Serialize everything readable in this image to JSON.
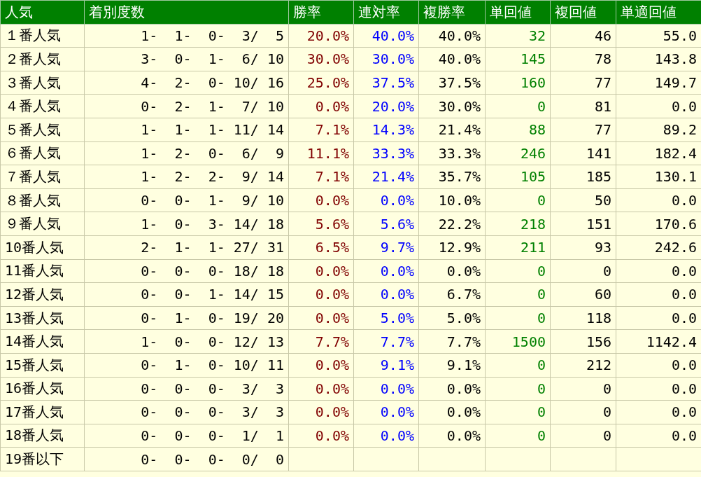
{
  "table": {
    "columns": [
      {
        "label": "人気",
        "kind": "name"
      },
      {
        "label": "着別度数",
        "kind": "record"
      },
      {
        "label": "勝率",
        "kind": "win"
      },
      {
        "label": "連対率",
        "kind": "quinella"
      },
      {
        "label": "複勝率",
        "kind": "plain"
      },
      {
        "label": "単回値",
        "kind": "return"
      },
      {
        "label": "複回値",
        "kind": "plain"
      },
      {
        "label": "単適回値",
        "kind": "plain"
      }
    ],
    "rows": [
      [
        "１番人気",
        "1-  1-  0-  3/  5",
        "20.0%",
        "40.0%",
        "40.0%",
        "32",
        "46",
        "55.0"
      ],
      [
        "２番人気",
        "3-  0-  1-  6/ 10",
        "30.0%",
        "30.0%",
        "40.0%",
        "145",
        "78",
        "143.8"
      ],
      [
        "３番人気",
        "4-  2-  0- 10/ 16",
        "25.0%",
        "37.5%",
        "37.5%",
        "160",
        "77",
        "149.7"
      ],
      [
        "４番人気",
        "0-  2-  1-  7/ 10",
        "0.0%",
        "20.0%",
        "30.0%",
        "0",
        "81",
        "0.0"
      ],
      [
        "５番人気",
        "1-  1-  1- 11/ 14",
        "7.1%",
        "14.3%",
        "21.4%",
        "88",
        "77",
        "89.2"
      ],
      [
        "６番人気",
        "1-  2-  0-  6/  9",
        "11.1%",
        "33.3%",
        "33.3%",
        "246",
        "141",
        "182.4"
      ],
      [
        "７番人気",
        "1-  2-  2-  9/ 14",
        "7.1%",
        "21.4%",
        "35.7%",
        "105",
        "185",
        "130.1"
      ],
      [
        "８番人気",
        "0-  0-  1-  9/ 10",
        "0.0%",
        "0.0%",
        "10.0%",
        "0",
        "50",
        "0.0"
      ],
      [
        "９番人気",
        "1-  0-  3- 14/ 18",
        "5.6%",
        "5.6%",
        "22.2%",
        "218",
        "151",
        "170.6"
      ],
      [
        "10番人気",
        "2-  1-  1- 27/ 31",
        "6.5%",
        "9.7%",
        "12.9%",
        "211",
        "93",
        "242.6"
      ],
      [
        "11番人気",
        "0-  0-  0- 18/ 18",
        "0.0%",
        "0.0%",
        "0.0%",
        "0",
        "0",
        "0.0"
      ],
      [
        "12番人気",
        "0-  0-  1- 14/ 15",
        "0.0%",
        "0.0%",
        "6.7%",
        "0",
        "60",
        "0.0"
      ],
      [
        "13番人気",
        "0-  1-  0- 19/ 20",
        "0.0%",
        "5.0%",
        "5.0%",
        "0",
        "118",
        "0.0"
      ],
      [
        "14番人気",
        "1-  0-  0- 12/ 13",
        "7.7%",
        "7.7%",
        "7.7%",
        "1500",
        "156",
        "1142.4"
      ],
      [
        "15番人気",
        "0-  1-  0- 10/ 11",
        "0.0%",
        "9.1%",
        "9.1%",
        "0",
        "212",
        "0.0"
      ],
      [
        "16番人気",
        "0-  0-  0-  3/  3",
        "0.0%",
        "0.0%",
        "0.0%",
        "0",
        "0",
        "0.0"
      ],
      [
        "17番人気",
        "0-  0-  0-  3/  3",
        "0.0%",
        "0.0%",
        "0.0%",
        "0",
        "0",
        "0.0"
      ],
      [
        "18番人気",
        "0-  0-  0-  1/  1",
        "0.0%",
        "0.0%",
        "0.0%",
        "0",
        "0",
        "0.0"
      ],
      [
        "19番以下",
        "0-  0-  0-  0/  0"
      ]
    ]
  }
}
